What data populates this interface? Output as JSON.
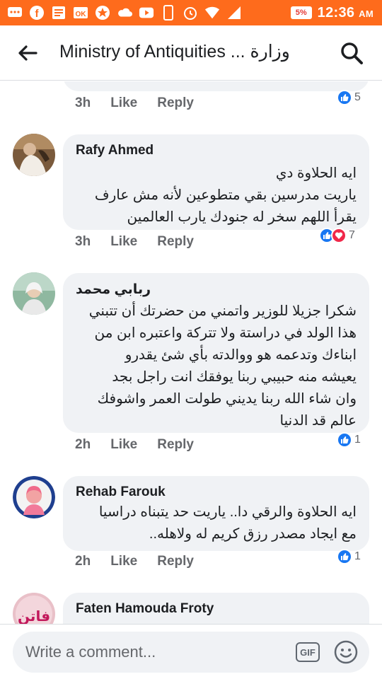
{
  "status_bar": {
    "time": "12:36",
    "ampm": "AM",
    "battery": "5%",
    "icons": [
      "messages-icon",
      "facebook-icon",
      "news-icon",
      "ok-icon",
      "star-icon",
      "soundcloud-icon",
      "youtube-icon",
      "phone-icon",
      "alarm-icon",
      "wifi-icon",
      "signal-icon"
    ]
  },
  "app_bar": {
    "title": "Ministry of Antiquities ... وزارة"
  },
  "comments": [
    {
      "author": "",
      "text": "",
      "time": "3h",
      "like": "Like",
      "reply": "Reply",
      "reactions": [
        "like"
      ],
      "reaction_count": "5"
    },
    {
      "author": "Rafy Ahmed",
      "text_lines": [
        "ايه الحلاوة دي",
        "ياريت مدرسين بقي متطوعين لأنه مش عارف",
        "يقرأ   اللهم سخر له جنودك يارب العالمين"
      ],
      "time": "3h",
      "like": "Like",
      "reply": "Reply",
      "reactions": [
        "like",
        "love"
      ],
      "reaction_count": "7"
    },
    {
      "author": "ربابي محمد",
      "text_lines": [
        "شكرا جزيلا للوزير واتمني من حضرتك أن تتبني",
        "هذا الولد في دراستة ولا تتركة واعتبره ابن من",
        "ابناءك وتدعمه هو ووالدته بأي شئ يقدرو",
        "يعيشه منه حبيبي ربنا يوفقك انت راجل بجد",
        "وان شاء الله ربنا يديني طولت العمر واشوفك",
        "عالم قد الدنيا"
      ],
      "time": "2h",
      "like": "Like",
      "reply": "Reply",
      "reactions": [
        "like"
      ],
      "reaction_count": "1"
    },
    {
      "author": "Rehab Farouk",
      "text_lines": [
        "ايه الحلاوة والرقي دا.. ياريت حد يتبناه دراسيا",
        "مع ايجاد مصدر رزق كريم له ولاهله.."
      ],
      "time": "2h",
      "like": "Like",
      "reply": "Reply",
      "reactions": [
        "like"
      ],
      "reaction_count": "1"
    },
    {
      "author": "Faten Hamouda Froty",
      "text_lines": [],
      "avatar_text": "فاتن"
    }
  ],
  "composer": {
    "placeholder": "Write a comment...",
    "gif_label": "GIF"
  },
  "colors": {
    "status_bar": "#fe6b1c",
    "bubble": "#f0f2f5",
    "like_blue": "#1877f2",
    "love_red": "#f0284a",
    "meta_gray": "#65676b"
  }
}
